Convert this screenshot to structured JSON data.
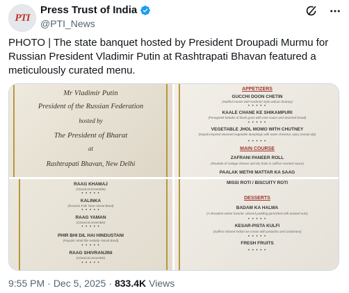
{
  "account": {
    "display_name": "Press Trust of India",
    "handle": "@PTI_News",
    "avatar_text": "PTI"
  },
  "tweet": {
    "text": "PHOTO | The state banquet hosted by President Droupadi Murmu for Russian President Vladimir Putin at Rashtrapati Bhavan featured a meticulously curated menu."
  },
  "menu_card": {
    "lines": [
      "Mr Vladimir Putin",
      "President of the Russian Federation",
      "hosted by",
      "The President of Bharat",
      "at",
      "Rashtrapati Bhavan, New Delhi"
    ]
  },
  "menu_food": {
    "appetizers_heading": "APPETIZERS",
    "appetizers": [
      {
        "name": "GUCCHI DOON CHETIN",
        "desc": "(Stuffed morels with Kashmiri style walnut chutney)"
      },
      {
        "name": "KAALE CHANE KE SHIKAMPURI",
        "desc": "(Fenugreek kebabs of black gram with mint sauce and steamed bread)"
      },
      {
        "name": "VEGETABLE JHOL MOMO WITH CHUTNEY",
        "desc": "(Nepali-inspired steamed vegetable dumplings with water chestnut, spicy tomato dip)"
      }
    ],
    "main_heading": "MAIN COURSE",
    "main": [
      {
        "name": "ZAFRANI PANEER ROLL",
        "desc": "(Roulade of cottage cheese and dry fruits in saffron scented sauce)"
      },
      {
        "name": "PAALAK METHI MATTAR KA SAAG",
        "desc": ""
      }
    ],
    "stars": "• • • • •"
  },
  "menu_music": {
    "items": [
      {
        "name": "RAAG KHAMAJ",
        "desc": "(Classical Ensemble)"
      },
      {
        "name": "KALINKA",
        "desc": "(Russian Folk Tune–Naval Band)"
      },
      {
        "name": "RAAG YAMAN",
        "desc": "(Classical ensemble)"
      },
      {
        "name": "PHIR BHI DIL HAI HINDUSTANI",
        "desc": "(Popular Hindi film melody–Naval Band)"
      },
      {
        "name": "RAAG SHIVRANJINI",
        "desc": "(Classical ensemble)"
      }
    ],
    "stars": "• • • • •"
  },
  "menu_dessert": {
    "top_line": "MISSI ROTI / BISCUITY ROTI",
    "heading": "DESSERTS",
    "items": [
      {
        "name": "BADAM KA HALWA",
        "desc": "(A decadent winter favorite: almond pudding garnished with toasted nuts)"
      },
      {
        "name": "KESAR-PISTA KULFI",
        "desc": "(Saffron infused Indian ice cream with pistachio and cardamom)"
      },
      {
        "name": "FRESH FRUITS",
        "desc": ""
      }
    ],
    "stars": "• • • • •"
  },
  "footer": {
    "time": "9:55 PM",
    "separator": "·",
    "date": "Dec 5, 2025",
    "views_count": "833.4K",
    "views_label": "Views"
  },
  "colors": {
    "verified_badge": "#1d9bf0",
    "menu_heading": "#a0382f",
    "gold_border": "#b8963e"
  },
  "icons": [
    "verified-badge-icon",
    "grok-icon",
    "more-icon"
  ]
}
